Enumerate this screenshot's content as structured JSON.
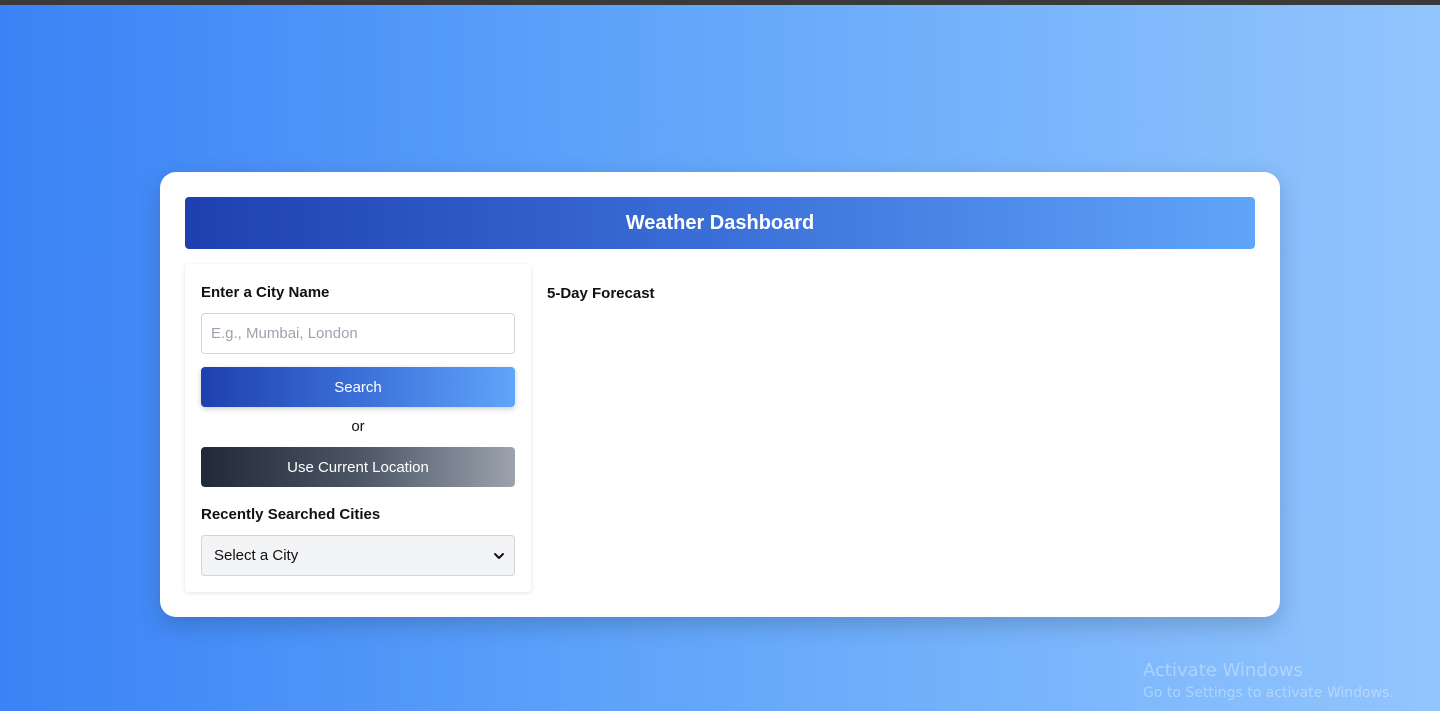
{
  "header": {
    "title": "Weather Dashboard"
  },
  "search": {
    "label": "Enter a City Name",
    "placeholder": "E.g., Mumbai, London",
    "value": "",
    "search_button": "Search",
    "or_text": "or",
    "location_button": "Use Current Location"
  },
  "recent": {
    "label": "Recently Searched Cities",
    "selected": "Select a City"
  },
  "forecast": {
    "title": "5-Day Forecast"
  },
  "watermark": {
    "title": "Activate Windows",
    "subtitle": "Go to Settings to activate Windows."
  },
  "colors": {
    "background_start": "#3b82f6",
    "background_end": "#93c5fd",
    "header_start": "#1e40af",
    "header_end": "#60a5fa",
    "location_start": "#1f2937",
    "location_end": "#9ca3af"
  },
  "icons": {
    "select_arrow": "chevron-down-icon"
  }
}
